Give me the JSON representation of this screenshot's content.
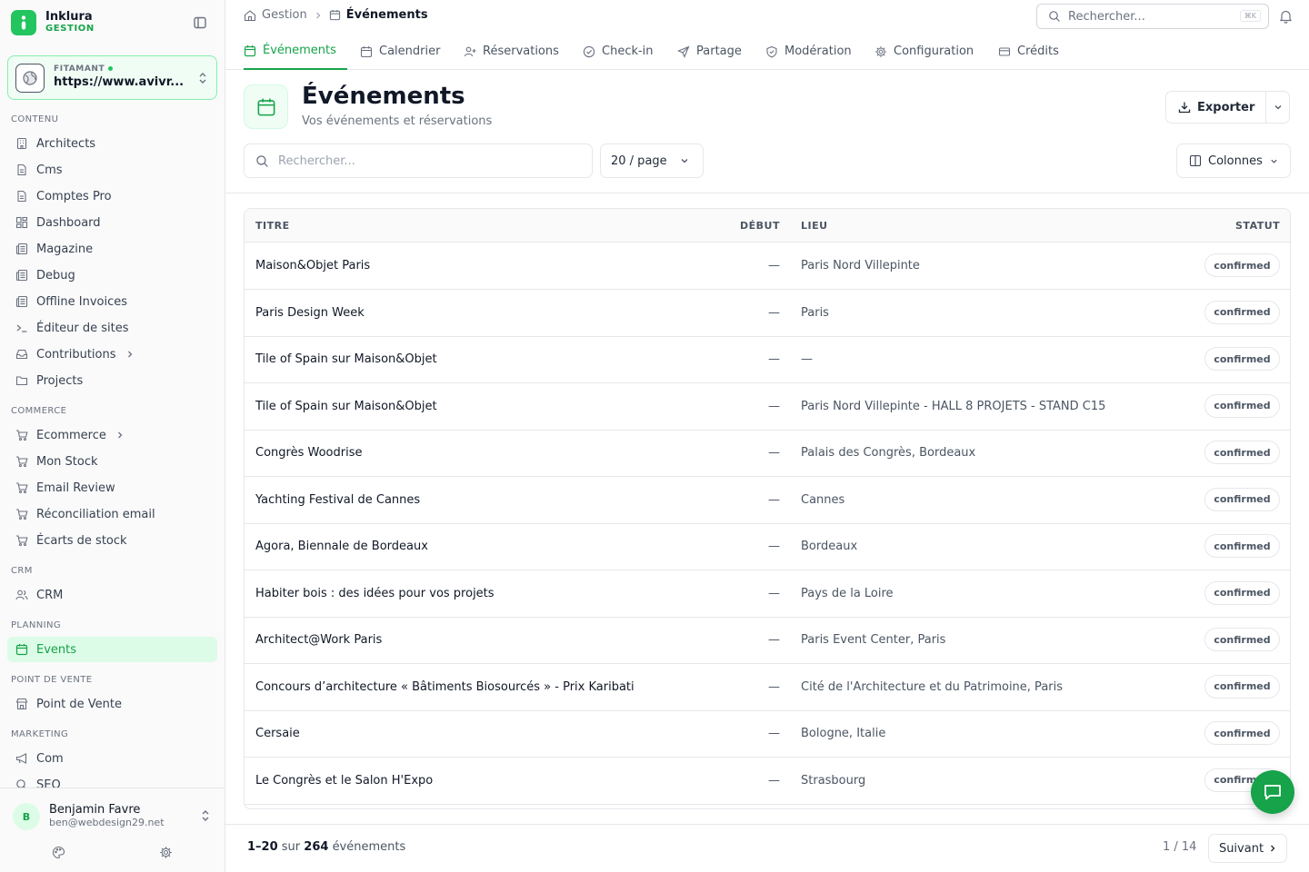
{
  "brand": {
    "name": "Inklura",
    "subtitle": "GESTION"
  },
  "site": {
    "label": "FITAMANT",
    "url": "https://www.avivr..."
  },
  "nav": {
    "sections": [
      {
        "title": "CONTENU",
        "items": [
          {
            "label": "Architects",
            "icon": "building-icon"
          },
          {
            "label": "Cms",
            "icon": "document-icon"
          },
          {
            "label": "Comptes Pro",
            "icon": "document-icon"
          },
          {
            "label": "Dashboard",
            "icon": "dashboard-grid-icon"
          },
          {
            "label": "Magazine",
            "icon": "newspaper-icon"
          },
          {
            "label": "Debug",
            "icon": "newspaper-icon"
          },
          {
            "label": "Offline Invoices",
            "icon": "newspaper-icon"
          },
          {
            "label": "Éditeur de sites",
            "icon": "terminal-icon"
          },
          {
            "label": "Contributions",
            "icon": "inbox-icon"
          },
          {
            "label": "Projects",
            "icon": "folder-icon"
          }
        ]
      },
      {
        "title": "COMMERCE",
        "items": [
          {
            "label": "Ecommerce",
            "icon": "cart-icon"
          },
          {
            "label": "Mon Stock",
            "icon": "cart-icon"
          },
          {
            "label": "Email Review",
            "icon": "cart-icon"
          },
          {
            "label": "Réconciliation email",
            "icon": "cart-icon"
          },
          {
            "label": "Écarts de stock",
            "icon": "cart-icon"
          }
        ]
      },
      {
        "title": "CRM",
        "items": [
          {
            "label": "CRM",
            "icon": "users-icon"
          }
        ]
      },
      {
        "title": "PLANNING",
        "items": [
          {
            "label": "Events",
            "icon": "calendar-icon"
          }
        ]
      },
      {
        "title": "POINT DE VENTE",
        "items": [
          {
            "label": "Point de Vente",
            "icon": "store-icon"
          }
        ]
      },
      {
        "title": "MARKETING",
        "items": [
          {
            "label": "Com",
            "icon": "megaphone-icon"
          },
          {
            "label": "SEO",
            "icon": "search-icon"
          }
        ]
      }
    ]
  },
  "user": {
    "initial": "B",
    "name": "Benjamin Favre",
    "email": "ben@webdesign29.net"
  },
  "breadcrumb": {
    "root": "Gestion",
    "current": "Événements"
  },
  "top_search": {
    "placeholder": "Rechercher...",
    "shortcut": "⌘K"
  },
  "tabs": [
    {
      "label": "Événements",
      "icon": "calendar-icon",
      "active": true
    },
    {
      "label": "Calendrier",
      "icon": "calendar-icon"
    },
    {
      "label": "Réservations",
      "icon": "user-plus-icon"
    },
    {
      "label": "Check-in",
      "icon": "check-circle-icon"
    },
    {
      "label": "Partage",
      "icon": "send-icon"
    },
    {
      "label": "Modération",
      "icon": "shield-icon"
    },
    {
      "label": "Configuration",
      "icon": "gear-icon"
    },
    {
      "label": "Crédits",
      "icon": "credit-card-icon"
    }
  ],
  "header": {
    "title": "Événements",
    "subtitle": "Vos événements et réservations",
    "export_label": "Exporter"
  },
  "filters": {
    "search_placeholder": "Rechercher...",
    "per_page": "20 / page",
    "columns_label": "Colonnes"
  },
  "table": {
    "columns": {
      "title": "TITRE",
      "start": "DÉBUT",
      "place": "LIEU",
      "status": "STATUT"
    },
    "rows": [
      {
        "title": "Maison&Objet Paris",
        "start": "—",
        "place": "Paris Nord Villepinte",
        "status": "confirmed"
      },
      {
        "title": "Paris Design Week",
        "start": "—",
        "place": "Paris",
        "status": "confirmed"
      },
      {
        "title": "Tile of Spain sur Maison&Objet",
        "start": "—",
        "place": "—",
        "status": "confirmed"
      },
      {
        "title": "Tile of Spain sur Maison&Objet",
        "start": "—",
        "place": "Paris Nord Villepinte - HALL 8 PROJETS - STAND C15",
        "status": "confirmed"
      },
      {
        "title": "Congrès Woodrise",
        "start": "—",
        "place": "Palais des Congrès, Bordeaux",
        "status": "confirmed"
      },
      {
        "title": "Yachting Festival de Cannes",
        "start": "—",
        "place": "Cannes",
        "status": "confirmed"
      },
      {
        "title": "Agora, Biennale de Bordeaux",
        "start": "—",
        "place": "Bordeaux",
        "status": "confirmed"
      },
      {
        "title": "Habiter bois : des idées pour vos projets",
        "start": "—",
        "place": "Pays de la Loire",
        "status": "confirmed"
      },
      {
        "title": "Architect@Work Paris",
        "start": "—",
        "place": "Paris Event Center, Paris",
        "status": "confirmed"
      },
      {
        "title": "Concours d’architecture « Bâtiments Biosourcés » - Prix Karibati",
        "start": "—",
        "place": "Cité de l'Architecture et du Patrimoine, Paris",
        "status": "confirmed"
      },
      {
        "title": "Cersaie",
        "start": "—",
        "place": "Bologne, Italie",
        "status": "confirmed"
      },
      {
        "title": "Le Congrès et le Salon H'Expo",
        "start": "—",
        "place": "Strasbourg",
        "status": "confirmed"
      }
    ]
  },
  "footer": {
    "range": "1–20",
    "of": "sur",
    "total": "264",
    "unit": "événements",
    "page": "1 / 14",
    "next_label": "Suivant"
  },
  "colors": {
    "accent": "#16a34a",
    "accent_light": "#dcfce7",
    "border": "#e5e7eb"
  }
}
